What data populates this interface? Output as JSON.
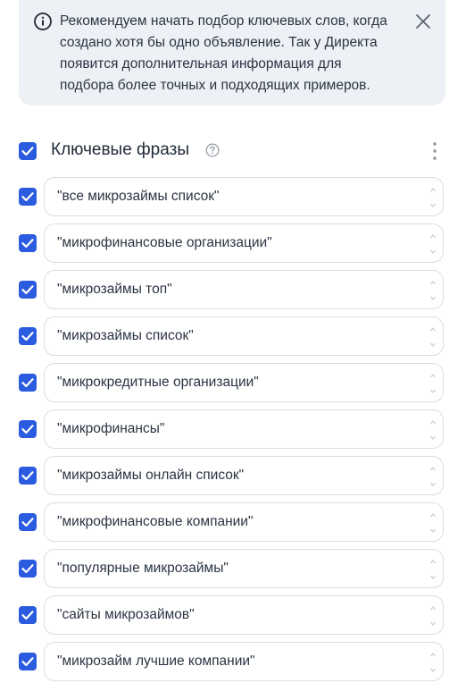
{
  "notice": {
    "text": "Рекомендуем начать подбор ключевых слов, когда создано хотя бы одно объявление. Так у Директа появится дополнительная информация для подбора более точных и подходящих примеров.",
    "icon": "info-icon",
    "close_icon": "close-icon"
  },
  "section": {
    "title": "Ключевые фразы",
    "checked": true,
    "help_icon": "help-icon",
    "more_icon": "more-vertical-icon"
  },
  "keywords": [
    {
      "text": "\"все микрозаймы список\"",
      "checked": true
    },
    {
      "text": "\"микрофинансовые организации\"",
      "checked": true
    },
    {
      "text": "\"микрозаймы топ\"",
      "checked": true
    },
    {
      "text": "\"микрозаймы список\"",
      "checked": true
    },
    {
      "text": "\"микрокредитные организации\"",
      "checked": true
    },
    {
      "text": "\"микрофинансы\"",
      "checked": true
    },
    {
      "text": "\"микрозаймы онлайн список\"",
      "checked": true
    },
    {
      "text": "\"микрофинансовые компании\"",
      "checked": true
    },
    {
      "text": "\"популярные микрозаймы\"",
      "checked": true
    },
    {
      "text": "\"сайты микрозаймов\"",
      "checked": true
    },
    {
      "text": "\"микрозайм лучшие компании\"",
      "checked": true
    }
  ],
  "colors": {
    "accent": "#2b5bde",
    "notice_bg": "#edf1f6",
    "border": "#d9dde4"
  }
}
